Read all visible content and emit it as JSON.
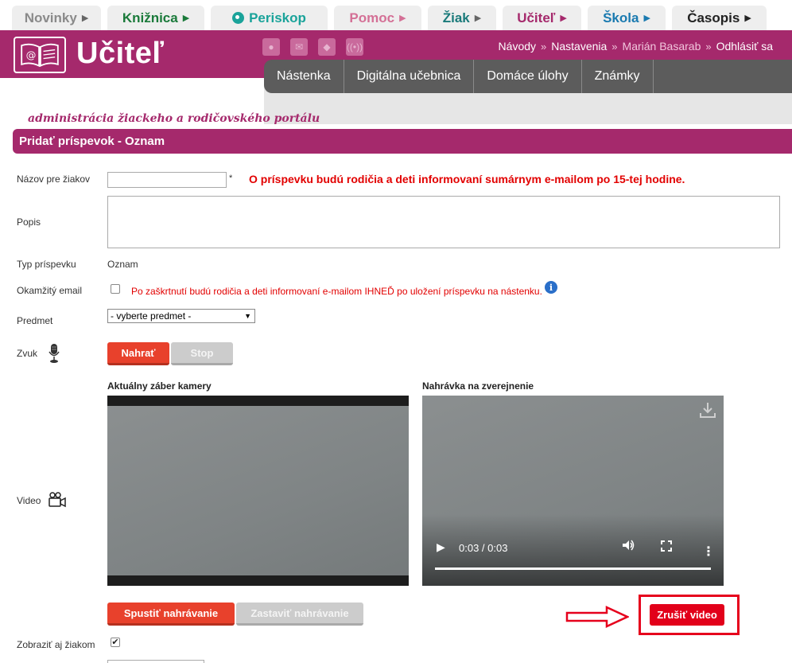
{
  "portal_tabs": [
    {
      "label": "Novinky",
      "color": "#8a8a8a"
    },
    {
      "label": "Knižnica",
      "color": "#1a7a3a"
    },
    {
      "label": "Periskop",
      "color": "#1aa39a"
    },
    {
      "label": "Pomoc",
      "color": "#d47096"
    },
    {
      "label": "Žiak",
      "color": "#1a7a7a"
    },
    {
      "label": "Učiteľ",
      "color": "#a5296c"
    },
    {
      "label": "Škola",
      "color": "#1a7ab0"
    },
    {
      "label": "Časopis",
      "color": "#222222"
    }
  ],
  "header": {
    "logo_text": "Učiteľ",
    "subtitle": "administrácia žiackeho a rodičovského portálu",
    "links": [
      "Návody",
      "Nastavenia",
      "Marián Basarab",
      "Odhlásiť sa"
    ],
    "nav": [
      "Nástenka",
      "Digitálna učebnica",
      "Domáce úlohy",
      "Známky"
    ]
  },
  "panel": {
    "title": "Pridať príspevok - Oznam"
  },
  "form": {
    "name_label": "Názov pre žiakov",
    "required_mark": "*",
    "notice": "O príspevku budú rodičia a deti informovaní sumárnym e-mailom po 15-tej hodine.",
    "desc_label": "Popis",
    "type_label": "Typ príspevku",
    "type_value": "Oznam",
    "email_label": "Okamžitý email",
    "email_notice": "Po zaškrtnutí budú rodičia a deti informovaní e-mailom IHNEĎ po uložení príspevku na nástenku.",
    "subject_label": "Predmet",
    "subject_value": "- vyberte predmet -",
    "sound_label": "Zvuk",
    "record_btn": "Nahrať",
    "stop_btn": "Stop",
    "video_label": "Video",
    "camera_title": "Aktuálny záber kamery",
    "recording_title": "Nahrávka na zverejnenie",
    "video_time": "0:03 / 0:03",
    "start_rec_btn": "Spustiť nahrávanie",
    "stop_rec_btn": "Zastaviť nahrávanie",
    "cancel_video_btn": "Zrušiť video",
    "show_students_label": "Zobraziť aj žiakom",
    "show_students_checked": true
  }
}
